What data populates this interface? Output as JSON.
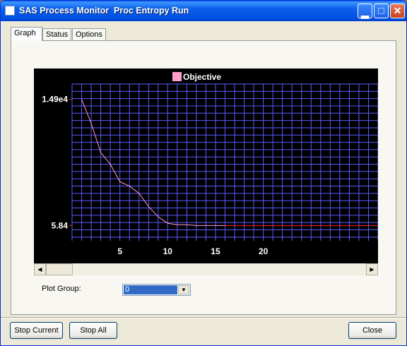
{
  "window": {
    "title": "SAS Process Monitor  Proc Entropy Run"
  },
  "tabs": [
    {
      "label": "Graph",
      "active": true
    },
    {
      "label": "Status",
      "active": false
    },
    {
      "label": "Options",
      "active": false
    }
  ],
  "chart_data": {
    "type": "line",
    "legend": "Objective",
    "series": [
      {
        "name": "Objective",
        "color": "#ff9ecb",
        "x": [
          1,
          2,
          3,
          4,
          5,
          6,
          7,
          8,
          9,
          10,
          11,
          12,
          13,
          14,
          15,
          16
        ],
        "y": [
          14900,
          11600,
          7600,
          6000,
          3600,
          3000,
          2000,
          200,
          -1200,
          -2100,
          -2300,
          -2300,
          -2400,
          -2400,
          -2400,
          -2400
        ]
      }
    ],
    "reference_line": {
      "y": -2400,
      "x_from": 16,
      "color": "#ff2a2a"
    },
    "y_tick_labels": [
      {
        "label": "1.49e4",
        "value": 14900
      },
      {
        "label": "5.84",
        "value": -2400
      }
    ],
    "x_ticks": [
      5,
      10,
      15,
      20
    ],
    "xlim": [
      0,
      32
    ],
    "ylim": [
      -4500,
      17000
    ],
    "grid": true
  },
  "controls": {
    "plot_group_label": "Plot Group:",
    "plot_group_value": "0"
  },
  "buttons": {
    "stop_current": "Stop Current",
    "stop_all": "Stop All",
    "close": "Close"
  },
  "colors": {
    "chart_bg": "#000000",
    "grid": "#5b5bff",
    "accent": "#0a5fe8"
  }
}
